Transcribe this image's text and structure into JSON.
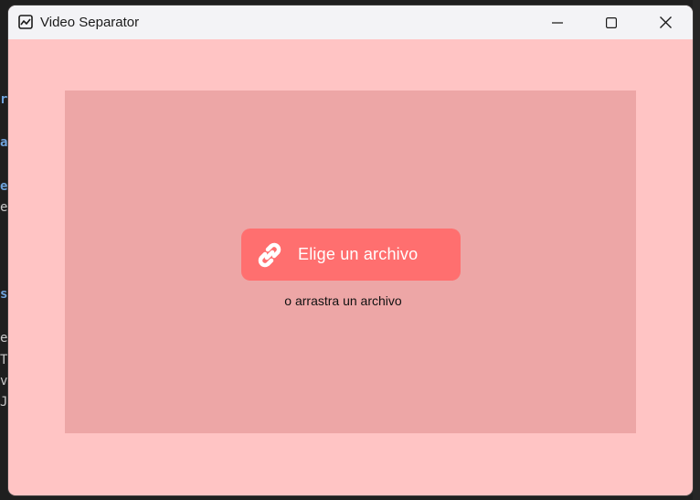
{
  "window": {
    "title": "Video Separator",
    "icons": {
      "app": "image-chart-icon",
      "minimize": "minimize-icon",
      "maximize": "maximize-icon",
      "close": "close-icon"
    }
  },
  "background_editor": {
    "fragments": [
      "r",
      "a",
      "e",
      "e",
      "s",
      "e",
      "T",
      "v",
      "J"
    ]
  },
  "dropzone": {
    "button_label": "Elige un archivo",
    "button_icon": "link-icon",
    "hint": "o arrastra un archivo"
  },
  "colors": {
    "window_bg": "#ffc4c4",
    "dropzone_bg": "#eda6a6",
    "button_bg": "#ff6f6f",
    "titlebar_bg": "#f3f3f6"
  }
}
